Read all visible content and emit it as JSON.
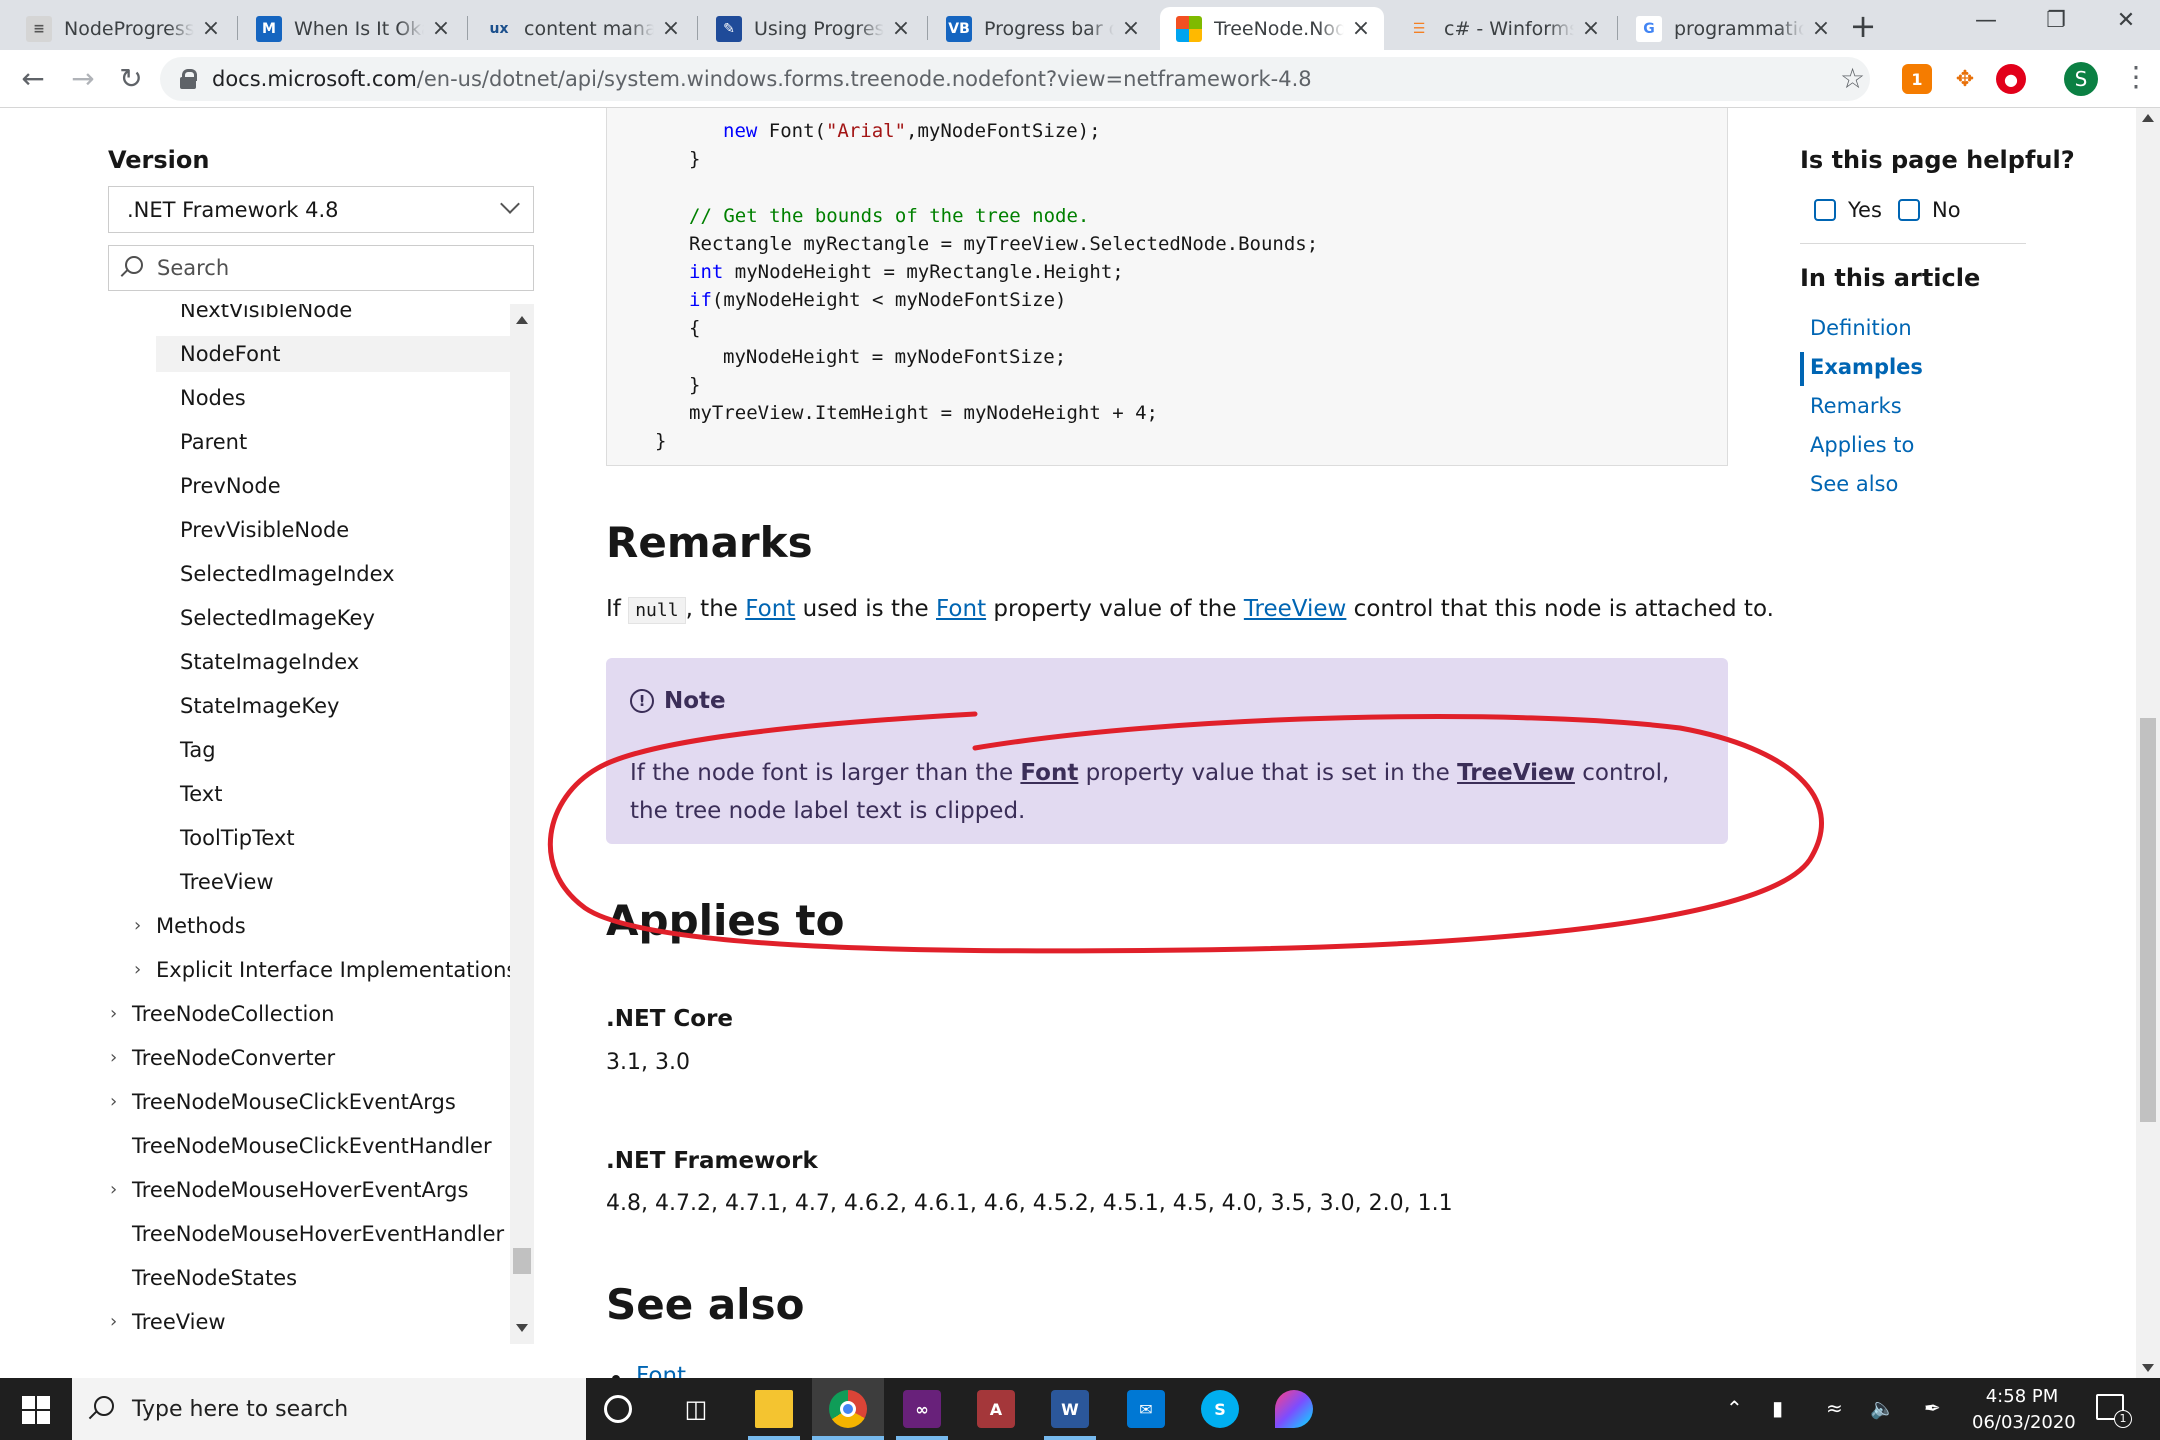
{
  "browser": {
    "tabs": [
      {
        "title": "NodeProgressBar",
        "icon": "devexpress-icon"
      },
      {
        "title": "When Is It Okay",
        "icon": "medium-icon"
      },
      {
        "title": "content management",
        "icon": "ux-icon"
      },
      {
        "title": "Using Progressbar",
        "icon": "codeproject-icon"
      },
      {
        "title": "Progress bar on",
        "icon": "vbforums-icon"
      },
      {
        "title": "TreeNode.NodeFont",
        "icon": "microsoft-icon"
      },
      {
        "title": "c# - Winforms Tr",
        "icon": "stackoverflow-icon"
      },
      {
        "title": "programmatically",
        "icon": "google-icon"
      }
    ],
    "active_tab": 5,
    "url_host": "docs.microsoft.com",
    "url_path": "/en-us/dotnet/api/system.windows.forms.treenode.nodefont?view=netframework-4.8",
    "profile_initial": "S",
    "extension_badge": "1"
  },
  "sidebar": {
    "version_label": "Version",
    "version_value": ".NET Framework 4.8",
    "search_placeholder": "Search",
    "toc_items": [
      {
        "label": "NextVisibleNode",
        "level": 2,
        "caret": false
      },
      {
        "label": "NodeFont",
        "level": 2,
        "caret": false,
        "selected": true
      },
      {
        "label": "Nodes",
        "level": 2,
        "caret": false
      },
      {
        "label": "Parent",
        "level": 2,
        "caret": false
      },
      {
        "label": "PrevNode",
        "level": 2,
        "caret": false
      },
      {
        "label": "PrevVisibleNode",
        "level": 2,
        "caret": false
      },
      {
        "label": "SelectedImageIndex",
        "level": 2,
        "caret": false
      },
      {
        "label": "SelectedImageKey",
        "level": 2,
        "caret": false
      },
      {
        "label": "StateImageIndex",
        "level": 2,
        "caret": false
      },
      {
        "label": "StateImageKey",
        "level": 2,
        "caret": false
      },
      {
        "label": "Tag",
        "level": 2,
        "caret": false
      },
      {
        "label": "Text",
        "level": 2,
        "caret": false
      },
      {
        "label": "ToolTipText",
        "level": 2,
        "caret": false
      },
      {
        "label": "TreeView",
        "level": 2,
        "caret": false
      },
      {
        "label": "Methods",
        "level": 1,
        "caret": true
      },
      {
        "label": "Explicit Interface Implementations",
        "level": 1,
        "caret": true
      },
      {
        "label": "TreeNodeCollection",
        "level": 0,
        "caret": true
      },
      {
        "label": "TreeNodeConverter",
        "level": 0,
        "caret": true
      },
      {
        "label": "TreeNodeMouseClickEventArgs",
        "level": 0,
        "caret": true
      },
      {
        "label": "TreeNodeMouseClickEventHandler",
        "level": 0,
        "caret": false
      },
      {
        "label": "TreeNodeMouseHoverEventArgs",
        "level": 0,
        "caret": true
      },
      {
        "label": "TreeNodeMouseHoverEventHandler",
        "level": 0,
        "caret": false
      },
      {
        "label": "TreeNodeStates",
        "level": 0,
        "caret": false
      },
      {
        "label": "TreeView",
        "level": 0,
        "caret": true
      }
    ]
  },
  "code": {
    "lines": [
      {
        "indent": 3,
        "tokens": [
          {
            "t": "new",
            "c": "kw"
          },
          {
            "t": " Font("
          },
          {
            "t": "\"Arial\"",
            "c": "str"
          },
          {
            "t": ",myNodeFontSize);"
          }
        ]
      },
      {
        "indent": 2,
        "tokens": [
          {
            "t": "}"
          }
        ]
      },
      {
        "indent": 0,
        "tokens": [
          {
            "t": ""
          }
        ]
      },
      {
        "indent": 2,
        "tokens": [
          {
            "t": "// Get the bounds of the tree node.",
            "c": "cm"
          }
        ]
      },
      {
        "indent": 2,
        "tokens": [
          {
            "t": "Rectangle myRectangle = myTreeView.SelectedNode.Bounds;"
          }
        ]
      },
      {
        "indent": 2,
        "tokens": [
          {
            "t": "int",
            "c": "kw"
          },
          {
            "t": " myNodeHeight = myRectangle.Height;"
          }
        ]
      },
      {
        "indent": 2,
        "tokens": [
          {
            "t": "if",
            "c": "kw"
          },
          {
            "t": "(myNodeHeight < myNodeFontSize)"
          }
        ]
      },
      {
        "indent": 2,
        "tokens": [
          {
            "t": "{"
          }
        ]
      },
      {
        "indent": 3,
        "tokens": [
          {
            "t": "myNodeHeight = myNodeFontSize;"
          }
        ]
      },
      {
        "indent": 2,
        "tokens": [
          {
            "t": "}"
          }
        ]
      },
      {
        "indent": 2,
        "tokens": [
          {
            "t": "myTreeView.ItemHeight = myNodeHeight + 4;"
          }
        ]
      },
      {
        "indent": 1,
        "tokens": [
          {
            "t": "}"
          }
        ]
      }
    ]
  },
  "remarks": {
    "heading": "Remarks",
    "p_if": "If ",
    "p_null": "null",
    "p_a": ", the ",
    "p_font1": "Font",
    "p_b": " used is the ",
    "p_font2": "Font",
    "p_c": " property value of the ",
    "p_treeview": "TreeView",
    "p_d": " control that this node is attached to."
  },
  "note": {
    "title": "Note",
    "b1": "If the node font is larger than the ",
    "link_font": "Font",
    "b2": " property value that is set in the ",
    "link_treeview": "TreeView",
    "b3": " control, the tree node label text is clipped."
  },
  "applies": {
    "heading": "Applies to",
    "products": [
      {
        "name": ".NET Core",
        "versions": "3.1, 3.0"
      },
      {
        "name": ".NET Framework",
        "versions": "4.8, 4.7.2, 4.7.1, 4.7, 4.6.2, 4.6.1, 4.6, 4.5.2, 4.5.1, 4.5, 4.0, 3.5, 3.0, 2.0, 1.1"
      }
    ]
  },
  "see_also": {
    "heading": "See also",
    "items": [
      "Font"
    ]
  },
  "right_rail": {
    "helpful": "Is this page helpful?",
    "yes": "Yes",
    "no": "No",
    "in_article": "In this article",
    "links": [
      "Definition",
      "Examples",
      "Remarks",
      "Applies to",
      "See also"
    ],
    "active_link": 1
  },
  "taskbar": {
    "search_placeholder": "Type here to search",
    "time": "4:58 PM",
    "date": "06/03/2020",
    "notification_count": "1"
  },
  "colors": {
    "link": "#0065b3",
    "note_bg": "#e2daf1",
    "note_text": "#3b2e58",
    "annotation_red": "#e0202a",
    "code_keyword": "#0101fd",
    "code_string": "#a31515",
    "code_comment": "#008000"
  }
}
